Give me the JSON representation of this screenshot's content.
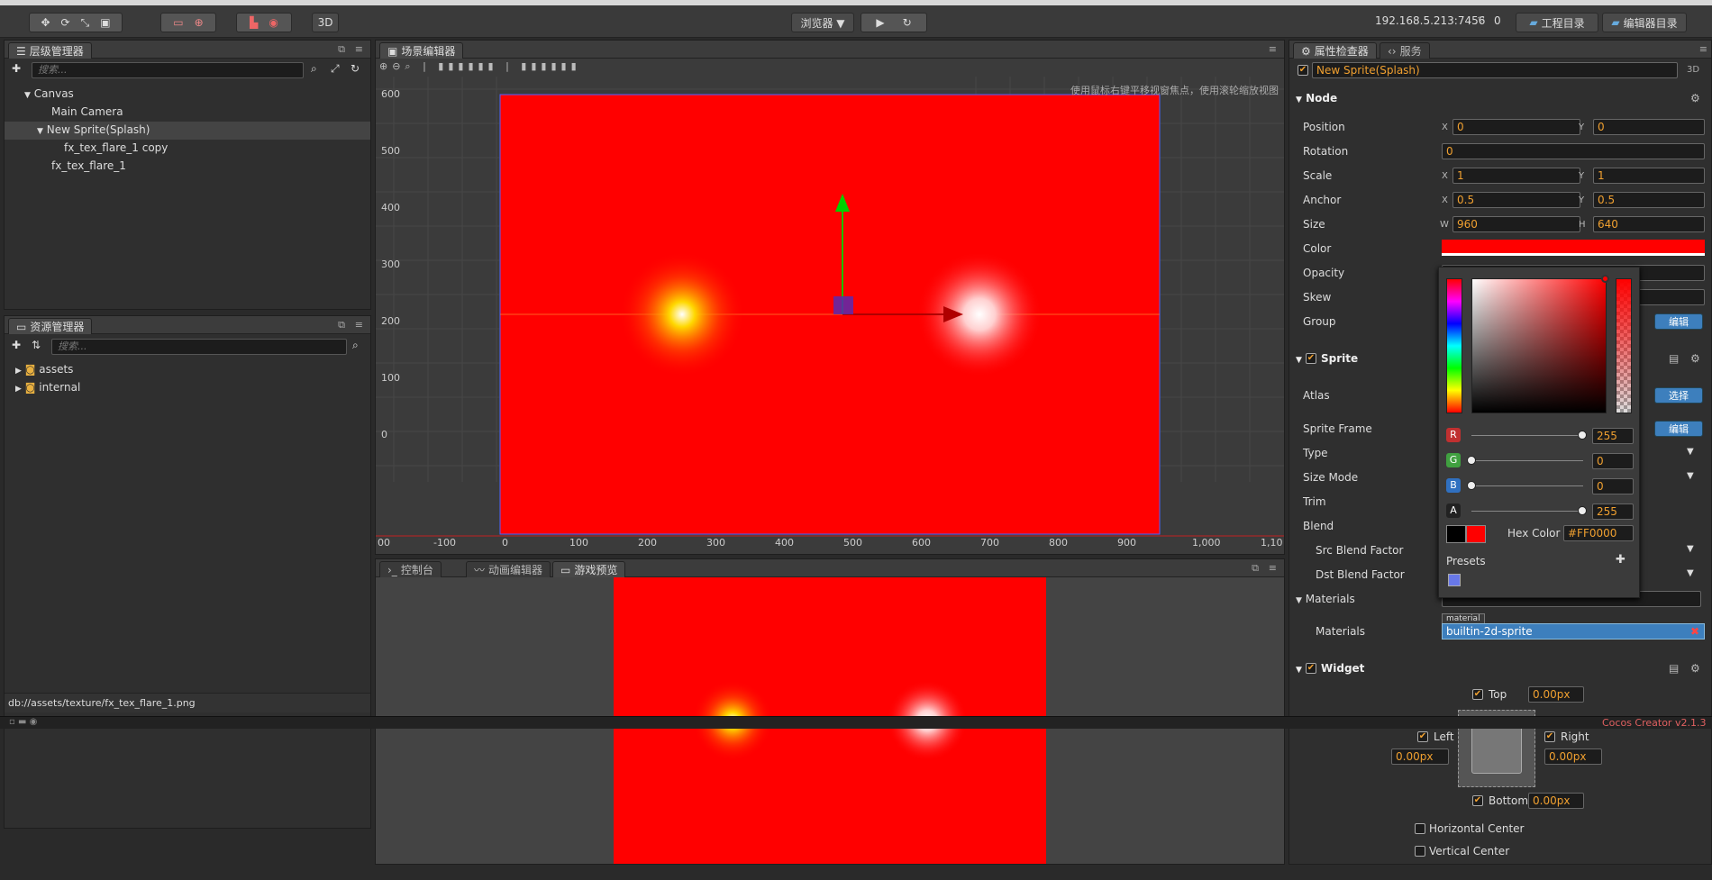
{
  "toolbar": {
    "preview_label": "浏览器 ▼",
    "mode_3d": "3D",
    "ip_address": "192.168.5.213:7456",
    "connections": "0",
    "project_dir": "工程目录",
    "editor_dir": "编辑器目录"
  },
  "hierarchy": {
    "title": "层级管理器",
    "search_placeholder": "搜索...",
    "nodes": [
      {
        "label": "Canvas"
      },
      {
        "label": "Main Camera"
      },
      {
        "label": "New Sprite(Splash)"
      },
      {
        "label": "fx_tex_flare_1 copy"
      },
      {
        "label": "fx_tex_flare_1"
      }
    ]
  },
  "assets": {
    "title": "资源管理器",
    "search_placeholder": "搜索...",
    "items": [
      {
        "label": "assets"
      },
      {
        "label": "internal"
      }
    ],
    "path": "db://assets/texture/fx_tex_flare_1.png"
  },
  "scene": {
    "title": "场景编辑器",
    "hint": "使用鼠标右键平移视窗焦点，使用滚轮缩放视图",
    "y_ticks": [
      "600",
      "500",
      "400",
      "300",
      "200",
      "100",
      "0"
    ],
    "x_ticks": [
      "00",
      "-100",
      "0",
      "100",
      "200",
      "300",
      "400",
      "500",
      "600",
      "700",
      "800",
      "900",
      "1,000",
      "1,10"
    ]
  },
  "bottom_tabs": {
    "console": "控制台",
    "animation": "动画编辑器",
    "preview": "游戏预览"
  },
  "inspector": {
    "tab_inspector": "属性检查器",
    "tab_services": "服务",
    "node_name": "New Sprite(Splash)",
    "badge_3d": "3D",
    "node_section": "Node",
    "position_label": "Position",
    "position_x": "0",
    "position_y": "0",
    "rotation_label": "Rotation",
    "rotation": "0",
    "scale_label": "Scale",
    "scale_x": "1",
    "scale_y": "1",
    "anchor_label": "Anchor",
    "anchor_x": "0.5",
    "anchor_y": "0.5",
    "size_label": "Size",
    "size_w": "960",
    "size_h": "640",
    "color_label": "Color",
    "opacity_label": "Opacity",
    "skew_label": "Skew",
    "group_label": "Group",
    "edit_button": "编辑",
    "sprite_section": "Sprite",
    "atlas_label": "Atlas",
    "select_button": "选择",
    "sprite_frame_label": "Sprite Frame",
    "type_label": "Type",
    "size_mode_label": "Size Mode",
    "trim_label": "Trim",
    "blend_label": "Blend",
    "src_blend_label": "Src Blend Factor",
    "dst_blend_label": "Dst Blend Factor",
    "materials_section": "Materials",
    "materials_label": "Materials",
    "material_tag": "material",
    "material_value": "builtin-2d-sprite",
    "widget_section": "Widget",
    "top_label": "Top",
    "top_value": "0.00px",
    "left_label": "Left",
    "left_value": "0.00px",
    "right_label": "Right",
    "right_value": "0.00px",
    "bottom_label": "Bottom",
    "bottom_value": "0.00px",
    "hcenter_label": "Horizontal Center",
    "vcenter_label": "Vertical Center"
  },
  "color_picker": {
    "r_label": "R",
    "r_value": "255",
    "g_label": "G",
    "g_value": "0",
    "b_label": "B",
    "b_value": "0",
    "a_label": "A",
    "a_value": "255",
    "hex_label": "Hex Color",
    "hex_value": "#FF0000",
    "presets_label": "Presets"
  },
  "footer": {
    "brand": "Cocos Creator v2.1.3"
  },
  "colors": {
    "accent_orange": "#f0a030",
    "scene_red": "#ff0000",
    "button_blue": "#3d7fbd"
  }
}
